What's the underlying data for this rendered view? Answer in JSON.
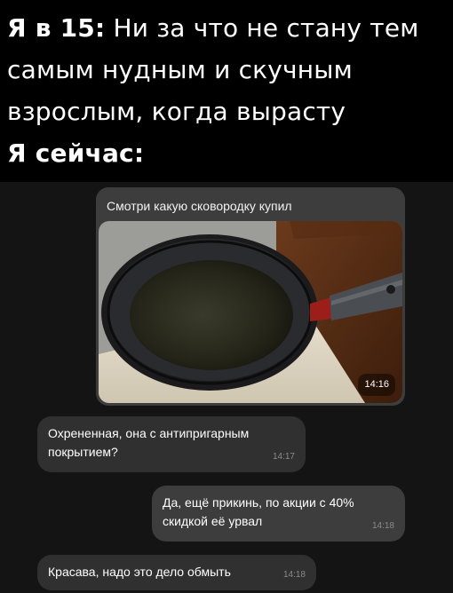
{
  "caption": {
    "line1_bold": "Я в 15:",
    "line1_text": " Ни за что не стану тем",
    "line2": "самым нудным и скучным",
    "line3": "взрослым, когда вырасту",
    "line4_bold": "Я сейчас:"
  },
  "chat": {
    "photo_message": {
      "caption": "Смотри какую сковородку купил",
      "image_icon": "frying-pan-photo",
      "time": "14:16"
    },
    "messages": [
      {
        "text": "Охрененная, она с антипригарным покрытием?",
        "time": "14:17",
        "direction": "incoming"
      },
      {
        "text": "Да, ещё прикинь, по акции с 40% скидкой её урвал",
        "time": "14:18",
        "direction": "outgoing"
      },
      {
        "text": "Красава, надо это дело обмыть",
        "time": "14:18",
        "direction": "incoming"
      }
    ]
  }
}
